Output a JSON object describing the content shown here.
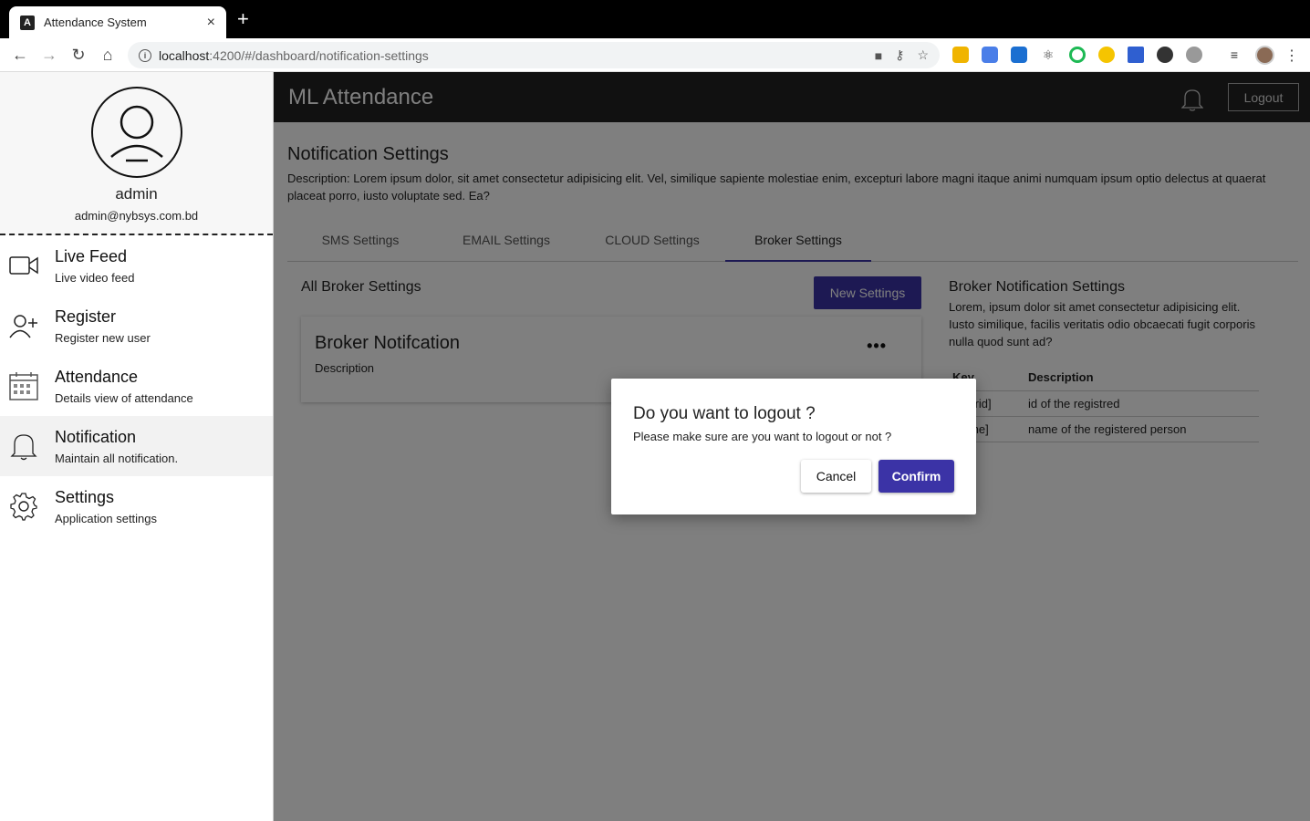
{
  "browser": {
    "tab_title": "Attendance System",
    "tab_favicon": "A",
    "tab_close": "×",
    "new_tab": "+",
    "url_host": "localhost",
    "url_rest": ":4200/#/dashboard/notification-settings"
  },
  "sidebar": {
    "username": "admin",
    "email": "admin@nybsys.com.bd",
    "items": [
      {
        "title": "Live Feed",
        "subtitle": "Live video feed",
        "icon": "video-camera-icon"
      },
      {
        "title": "Register",
        "subtitle": "Register new user",
        "icon": "add-user-icon"
      },
      {
        "title": "Attendance",
        "subtitle": "Details view of attendance",
        "icon": "calendar-icon"
      },
      {
        "title": "Notification",
        "subtitle": "Maintain all notification.",
        "icon": "bell-icon"
      },
      {
        "title": "Settings",
        "subtitle": "Application settings",
        "icon": "gear-icon"
      }
    ]
  },
  "header": {
    "title": "ML Attendance",
    "logout_label": "Logout"
  },
  "page": {
    "title": "Notification Settings",
    "description": "Description: Lorem ipsum dolor, sit amet consectetur adipisicing elit. Vel, similique sapiente molestiae enim, excepturi labore magni itaque animi numquam ipsum optio delectus at quaerat placeat porro, iusto voluptate sed. Ea?",
    "tabs": [
      "SMS Settings",
      "EMAIL Settings",
      "CLOUD Settings",
      "Broker Settings"
    ],
    "active_tab": "Broker Settings"
  },
  "broker": {
    "list_title": "All Broker Settings",
    "new_button": "New Settings",
    "card_title": "Broker Notifcation",
    "card_desc": "Description",
    "card_more": "•••",
    "info_title": "Broker Notification Settings",
    "info_desc": "Lorem, ipsum dolor sit amet consectetur adipisicing elit. Iusto similique, facilis veritatis odio obcaecati fugit corporis nulla quod sunt ad?",
    "table_headers": [
      "Key",
      "Description"
    ],
    "table_rows": [
      [
        "[userid]",
        "id of the registred"
      ],
      [
        "[name]",
        "name of the registered person"
      ]
    ]
  },
  "dialog": {
    "title": "Do you want to logout ?",
    "message": "Please make sure are you want to logout or not ?",
    "cancel": "Cancel",
    "confirm": "Confirm"
  },
  "colors": {
    "accent": "#3b33a6",
    "appbar": "#222222"
  }
}
